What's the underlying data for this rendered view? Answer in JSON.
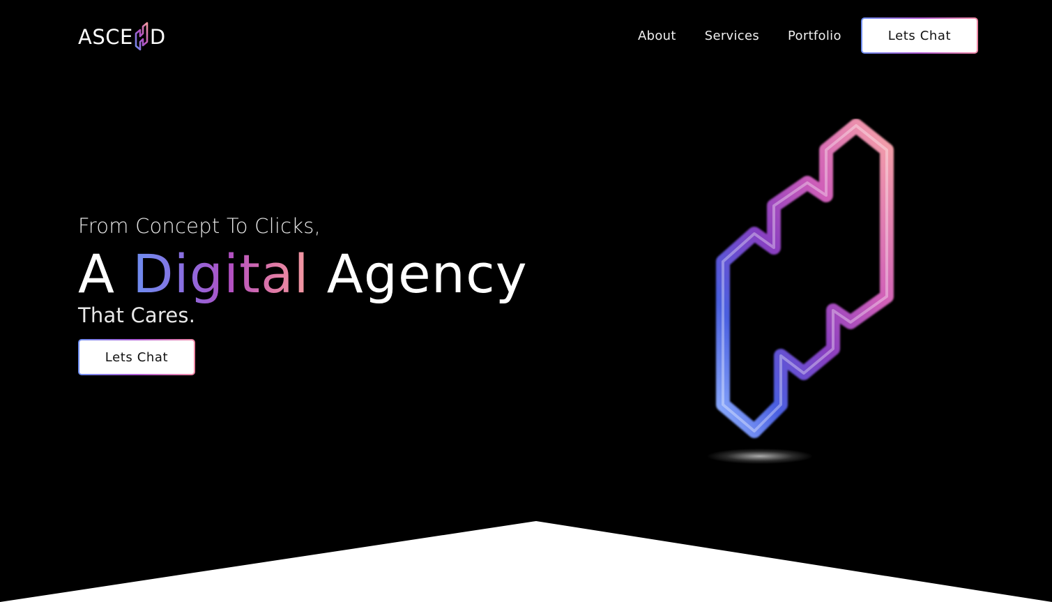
{
  "brand": {
    "name_left": "ASCE",
    "name_right": "D",
    "icon": "ascend-n-logo-icon"
  },
  "nav": {
    "links": [
      "About",
      "Services",
      "Portfolio"
    ],
    "cta_label": "Lets Chat"
  },
  "hero": {
    "line1": "From Concept To Clicks,",
    "title_prefix": "A ",
    "title_highlight": "Digital",
    "title_suffix": " Agency",
    "line3": "That Cares.",
    "cta_label": "Lets Chat"
  },
  "colors": {
    "background": "#000000",
    "gradient_blue": "#6d8ef0",
    "gradient_purple": "#b14fc2",
    "gradient_pink": "#f49aa0",
    "wave": "#ffffff"
  }
}
